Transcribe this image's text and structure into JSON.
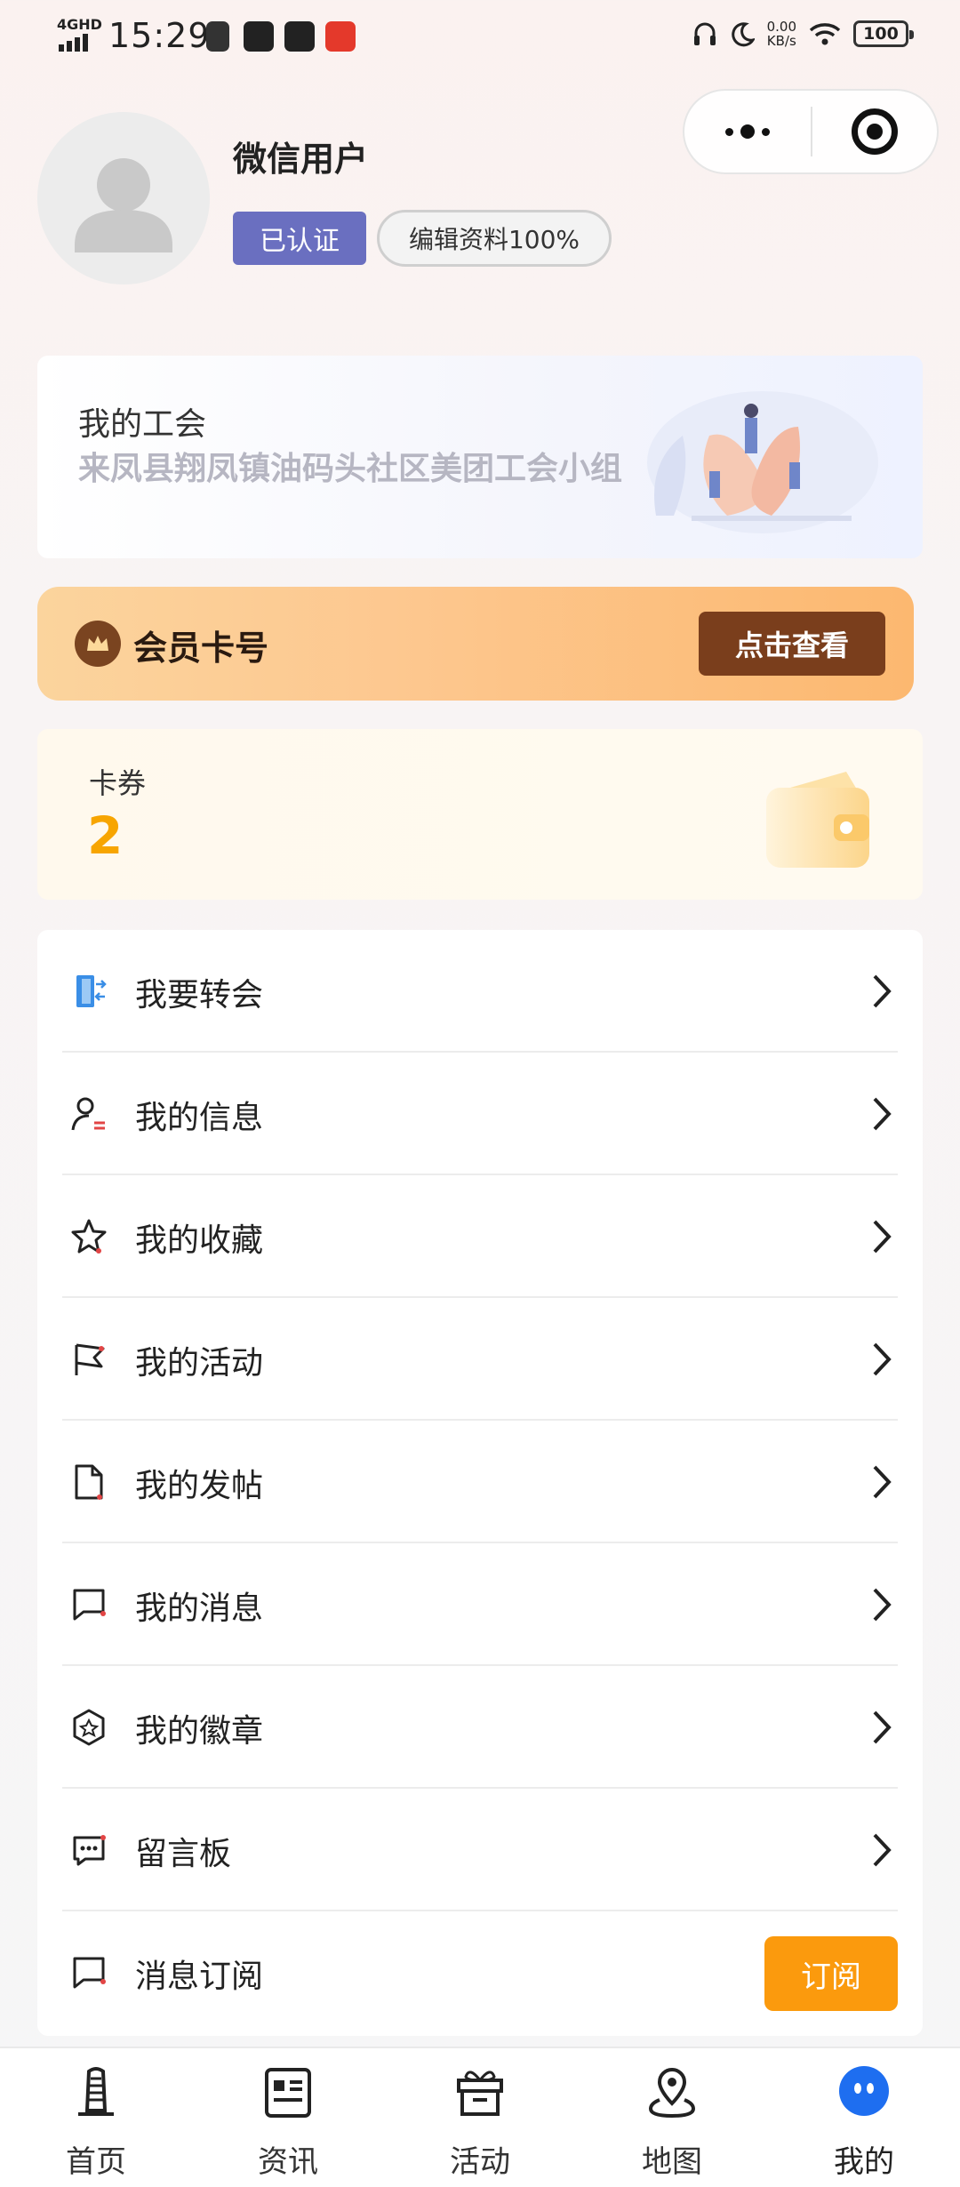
{
  "status_bar": {
    "network": "4GHD",
    "time": "15:29",
    "speed_value": "0.00",
    "speed_unit": "KB/s",
    "battery": "100"
  },
  "profile": {
    "name": "微信用户",
    "verified_badge": "已认证",
    "edit_profile_label": "编辑资料100%"
  },
  "union": {
    "title": "我的工会",
    "name": "来凤县翔凤镇油码头社区美团工会小组"
  },
  "member": {
    "label": "会员卡号",
    "button": "点击查看"
  },
  "coupon": {
    "label": "卡券",
    "count": "2"
  },
  "menu": {
    "items": [
      {
        "label": "我要转会",
        "icon": "transfer-door-icon"
      },
      {
        "label": "我的信息",
        "icon": "user-info-icon"
      },
      {
        "label": "我的收藏",
        "icon": "star-icon"
      },
      {
        "label": "我的活动",
        "icon": "flag-icon"
      },
      {
        "label": "我的发帖",
        "icon": "document-icon"
      },
      {
        "label": "我的消息",
        "icon": "message-icon"
      },
      {
        "label": "我的徽章",
        "icon": "badge-icon"
      },
      {
        "label": "留言板",
        "icon": "comment-board-icon"
      },
      {
        "label": "消息订阅",
        "icon": "subscribe-message-icon"
      }
    ],
    "subscribe_button": "订阅"
  },
  "tabbar": {
    "tabs": [
      {
        "label": "首页",
        "icon": "home-icon"
      },
      {
        "label": "资讯",
        "icon": "news-icon"
      },
      {
        "label": "活动",
        "icon": "gift-icon"
      },
      {
        "label": "地图",
        "icon": "map-pin-icon"
      },
      {
        "label": "我的",
        "icon": "profile-icon"
      }
    ],
    "active_index": 4
  },
  "colors": {
    "verified": "#6a6fc0",
    "member_button": "#7a3e1c",
    "coupon_count": "#f7a500",
    "subscribe": "#fb9a0d",
    "tab_active": "#1e6ef0"
  }
}
